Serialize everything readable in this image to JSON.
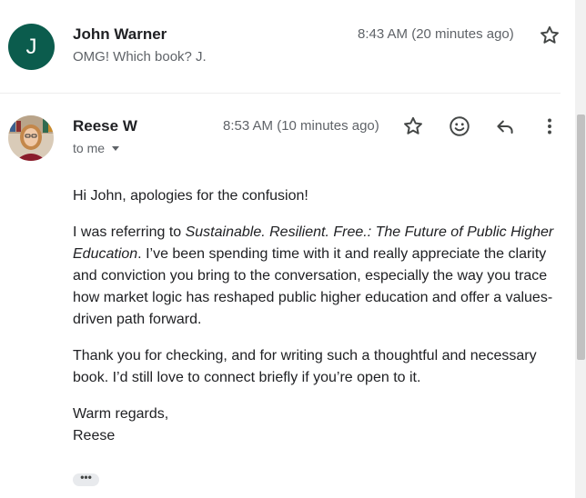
{
  "messages": [
    {
      "avatar_letter": "J",
      "sender": "John Warner",
      "time": "8:43 AM (20 minutes ago)",
      "snippet": "OMG! Which book? J.",
      "avatar_color": "#0b5c4d"
    },
    {
      "sender": "Reese W",
      "time": "8:53 AM (10 minutes ago)",
      "recipient": "to me",
      "body": {
        "greeting": "Hi John, apologies for the confusion!",
        "p1_before": "I was referring to ",
        "p1_title": "Sustainable. Resilient. Free.: The Future of Public Higher Education",
        "p1_after": ". I’ve been spending time with it and really appreciate the clarity and conviction you bring to the conversation, especially the way you trace how market logic has reshaped public higher education and offer a values-driven path forward.",
        "p2": "Thank you for checking, and for writing such a thoughtful and necessary book. I’d still love to connect briefly if you’re open to it.",
        "signoff": "Warm regards,",
        "signature": "Reese"
      },
      "trimmed_content_label": "•••"
    }
  ],
  "icons": {
    "star": "star-icon",
    "emoji": "emoji-icon",
    "reply": "reply-icon",
    "more": "more-vert-icon",
    "caret": "chevron-down-icon"
  }
}
